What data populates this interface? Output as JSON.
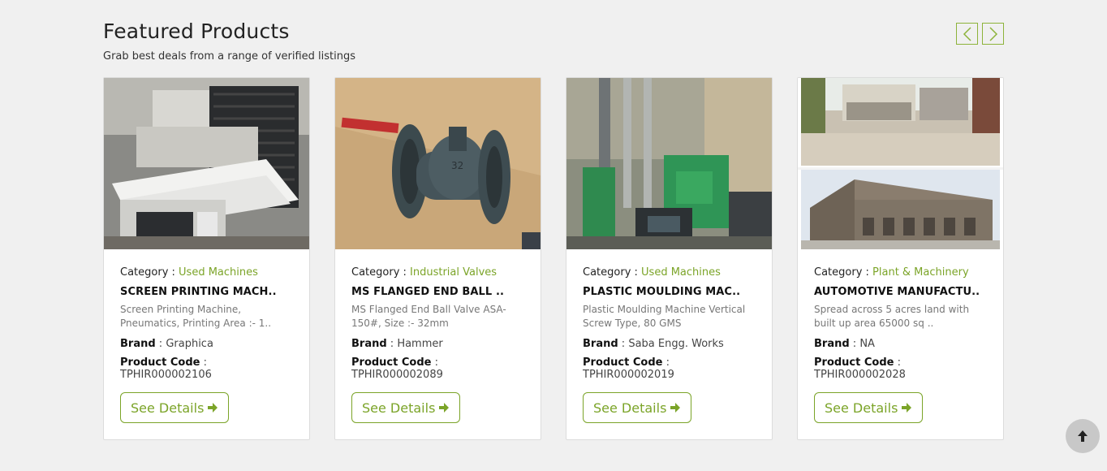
{
  "header": {
    "title": "Featured Products",
    "subtitle": "Grab best deals from a range of verified listings"
  },
  "carousel": {
    "prev_icon": "chevron-left-icon",
    "next_icon": "chevron-right-icon"
  },
  "labels": {
    "category": "Category : ",
    "brand": "Brand",
    "product_code": "Product Code",
    "see_details": "See Details"
  },
  "products": [
    {
      "category": "Used Machines",
      "name": "SCREEN PRINTING MACH..",
      "description": "Screen Printing Machine, Pneumatics, Printing Area :- 1..",
      "brand": "Graphica",
      "code": "TPHIR000002106",
      "image": "screen-printing-machine-photo"
    },
    {
      "category": "Industrial Valves",
      "name": "MS FLANGED END BALL ..",
      "description": "MS Flanged End Ball Valve ASA-150#, Size :- 32mm",
      "brand": "Hammer",
      "code": "TPHIR000002089",
      "image": "ball-valve-photo"
    },
    {
      "category": "Used Machines",
      "name": "PLASTIC MOULDING MAC..",
      "description": "Plastic Moulding Machine Vertical Screw Type, 80 GMS",
      "brand": "Saba Engg. Works",
      "code": "TPHIR000002019",
      "image": "plastic-moulding-machine-photo"
    },
    {
      "category": "Plant & Machinery",
      "name": "AUTOMOTIVE MANUFACTU..",
      "description": "Spread across 5 acres land with built up area 65000 sq ..",
      "brand": "NA",
      "code": "TPHIR000002028",
      "image": "factory-building-photo"
    }
  ],
  "colors": {
    "accent": "#7ba428",
    "background": "#f0f0f0"
  },
  "scroll_top_icon": "arrow-up-icon"
}
